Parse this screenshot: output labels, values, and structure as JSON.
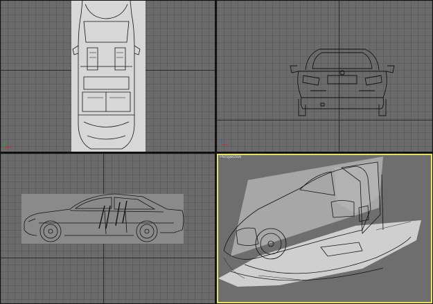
{
  "viewports": {
    "top": {
      "label": ""
    },
    "front": {
      "label": ""
    },
    "left": {
      "label": ""
    },
    "perspective": {
      "label": "Perspective"
    }
  },
  "colors": {
    "viewport_bg": "#6b6b6b",
    "separator": "#121212",
    "active_border": "#e6e25a",
    "blueprint_bg": "#d7d7d7",
    "line": "#111111"
  },
  "icons": {
    "gizmo": "axis-tripod-icon"
  }
}
